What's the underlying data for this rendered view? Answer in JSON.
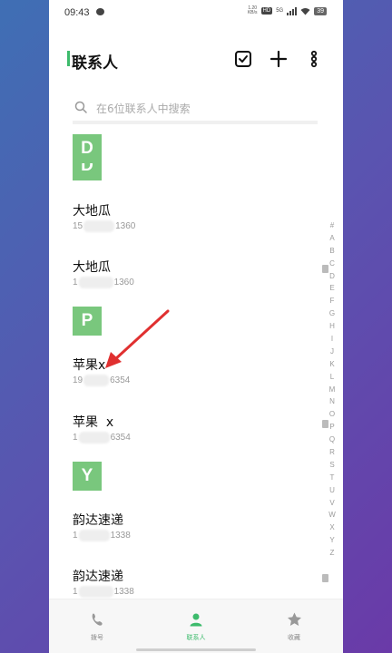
{
  "status_bar": {
    "time": "09:43",
    "speed": "1.20\nKB/s",
    "hd": "HD",
    "signal": "5G",
    "battery": "39"
  },
  "header": {
    "title": "联系人"
  },
  "search": {
    "placeholder": "在6位联系人中搜索"
  },
  "sections": [
    {
      "letter": "D",
      "peek_letter": "D"
    },
    {
      "letter": "P"
    },
    {
      "letter": "Y"
    }
  ],
  "contacts": [
    {
      "name": "大地瓜",
      "phone_start": "15",
      "phone_end": "1360"
    },
    {
      "name": "大地瓜",
      "phone_start": "1",
      "phone_end": "1360"
    },
    {
      "name": "苹果x",
      "phone_start": "19",
      "phone_end": "6354"
    },
    {
      "name": "苹果  x",
      "phone_start": "1",
      "phone_end": "6354"
    },
    {
      "name": "韵达速递",
      "phone_start": "1",
      "phone_end": "1338"
    },
    {
      "name": "韵达速递",
      "phone_start": "1",
      "phone_end": "1338"
    }
  ],
  "index_letters": [
    "#",
    "A",
    "B",
    "C",
    "D",
    "E",
    "F",
    "G",
    "H",
    "I",
    "J",
    "K",
    "L",
    "M",
    "N",
    "O",
    "P",
    "Q",
    "R",
    "S",
    "T",
    "U",
    "V",
    "W",
    "X",
    "Y",
    "Z"
  ],
  "nav": {
    "dial": "拨号",
    "contacts": "联系人",
    "favorites": "收藏"
  },
  "colors": {
    "accent": "#3dbb6c",
    "section_bg": "#79c77d",
    "annotation_arrow": "#e03030"
  }
}
